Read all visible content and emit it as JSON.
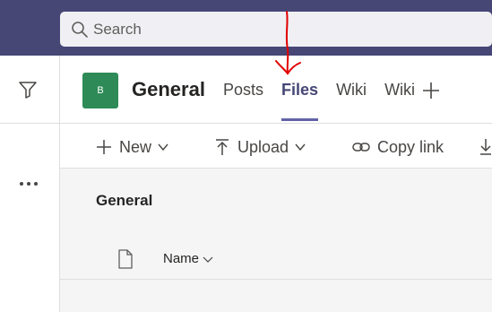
{
  "search": {
    "placeholder": "Search"
  },
  "team": {
    "avatar_letter": "B",
    "avatar_color": "#2e8b57"
  },
  "channel": {
    "title": "General"
  },
  "tabs": [
    {
      "label": "Posts",
      "active": false
    },
    {
      "label": "Files",
      "active": true
    },
    {
      "label": "Wiki",
      "active": false
    },
    {
      "label": "Wiki",
      "active": false
    }
  ],
  "toolbar": {
    "new_label": "New",
    "upload_label": "Upload",
    "copy_link_label": "Copy link"
  },
  "content": {
    "section_title": "General",
    "name_column": "Name"
  },
  "colors": {
    "topbar": "#464775",
    "accent": "#6264a7",
    "annotation": "#e00000"
  },
  "icons": [
    "search-icon",
    "filter-icon",
    "more-icon",
    "add-tab-icon",
    "plus-icon",
    "chevron-down-icon",
    "upload-icon",
    "link-icon",
    "download-icon",
    "file-icon"
  ]
}
